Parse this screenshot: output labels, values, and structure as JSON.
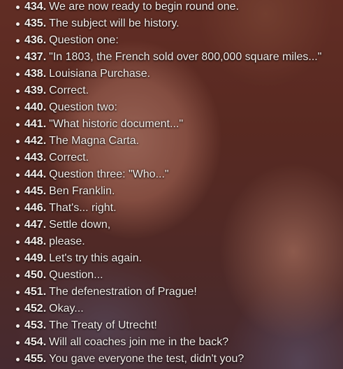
{
  "lines": [
    {
      "number": "434.",
      "text": "We are now ready to begin round one."
    },
    {
      "number": "435.",
      "text": "The subject will be history."
    },
    {
      "number": "436.",
      "text": "Question one:"
    },
    {
      "number": "437.",
      "text": "\"In 1803, the French sold over 800,000 square miles...\""
    },
    {
      "number": "438.",
      "text": "Louisiana Purchase."
    },
    {
      "number": "439.",
      "text": "Correct."
    },
    {
      "number": "440.",
      "text": "Question two:"
    },
    {
      "number": "441.",
      "text": "\"What historic document...\""
    },
    {
      "number": "442.",
      "text": "The Magna Carta."
    },
    {
      "number": "443.",
      "text": "Correct."
    },
    {
      "number": "444.",
      "text": "Question three: \"Who...\""
    },
    {
      "number": "445.",
      "text": "Ben Franklin."
    },
    {
      "number": "446.",
      "text": "That's... right."
    },
    {
      "number": "447.",
      "text": "Settle down,"
    },
    {
      "number": "448.",
      "text": "please."
    },
    {
      "number": "449.",
      "text": "Let's try this again."
    },
    {
      "number": "450.",
      "text": "Question..."
    },
    {
      "number": "451.",
      "text": "The defenestration of Prague!"
    },
    {
      "number": "452.",
      "text": "Okay..."
    },
    {
      "number": "453.",
      "text": "The Treaty of Utrecht!"
    },
    {
      "number": "454.",
      "text": "Will all coaches join me in the back?"
    },
    {
      "number": "455.",
      "text": "You gave everyone the test, didn't you?"
    }
  ]
}
